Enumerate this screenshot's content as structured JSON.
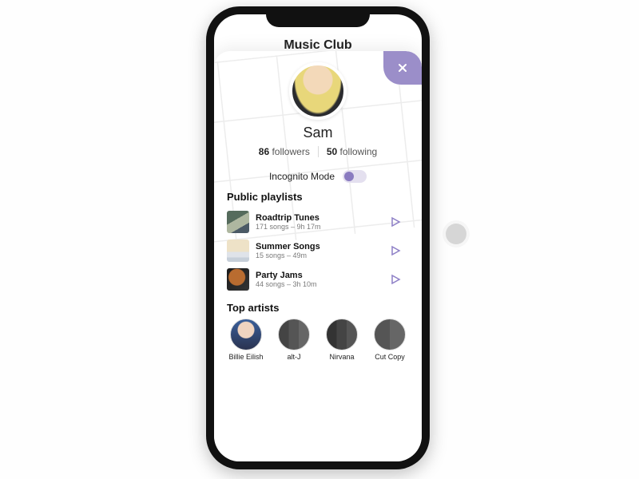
{
  "app": {
    "title": "Music Club"
  },
  "colors": {
    "accent": "#8a7bc0"
  },
  "profile": {
    "name": "Sam",
    "followers_count": "86",
    "followers_label": "followers",
    "following_count": "50",
    "following_label": "following"
  },
  "incognito": {
    "label": "Incognito Mode",
    "on": false
  },
  "sections": {
    "playlists_title": "Public playlists",
    "artists_title": "Top artists"
  },
  "playlists": [
    {
      "title": "Roadtrip Tunes",
      "meta": "171 songs – 9h 17m"
    },
    {
      "title": "Summer Songs",
      "meta": "15 songs – 49m"
    },
    {
      "title": "Party Jams",
      "meta": "44 songs – 3h 10m"
    }
  ],
  "artists": [
    {
      "name": "Billie Eilish"
    },
    {
      "name": "alt-J"
    },
    {
      "name": "Nirvana"
    },
    {
      "name": "Cut Copy"
    }
  ]
}
